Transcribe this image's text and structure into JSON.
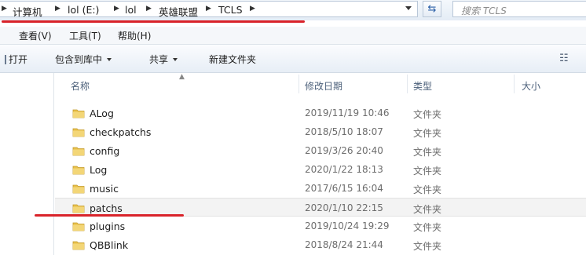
{
  "address_bar": {
    "crumbs": [
      "计算机",
      "lol (E:)",
      "lol",
      "英雄联盟",
      "TCLS"
    ],
    "search_placeholder": "搜索 TCLS"
  },
  "menu": {
    "items": [
      "查看(V)",
      "工具(T)",
      "帮助(H)"
    ]
  },
  "toolbar": {
    "open_label": "打开",
    "include_label": "包含到库中",
    "share_label": "共享",
    "new_folder_label": "新建文件夹"
  },
  "columns": {
    "name": "名称",
    "modified": "修改日期",
    "type": "类型",
    "size": "大小"
  },
  "files": [
    {
      "name": "ALog",
      "modified": "2019/11/19 10:46",
      "type": "文件夹"
    },
    {
      "name": "checkpatchs",
      "modified": "2018/5/10 18:07",
      "type": "文件夹"
    },
    {
      "name": "config",
      "modified": "2019/3/26 20:40",
      "type": "文件夹"
    },
    {
      "name": "Log",
      "modified": "2020/1/22 18:13",
      "type": "文件夹"
    },
    {
      "name": "music",
      "modified": "2017/6/15 16:04",
      "type": "文件夹"
    },
    {
      "name": "patchs",
      "modified": "2020/1/10 22:15",
      "type": "文件夹"
    },
    {
      "name": "plugins",
      "modified": "2019/10/24 19:29",
      "type": "文件夹"
    },
    {
      "name": "QBBlink",
      "modified": "2018/8/24 21:44",
      "type": "文件夹"
    }
  ],
  "selected_file": "patchs",
  "colors": {
    "annotation_red": "#d9232a",
    "folder_yellow": "#e8c04a",
    "header_text": "#4c607a"
  }
}
